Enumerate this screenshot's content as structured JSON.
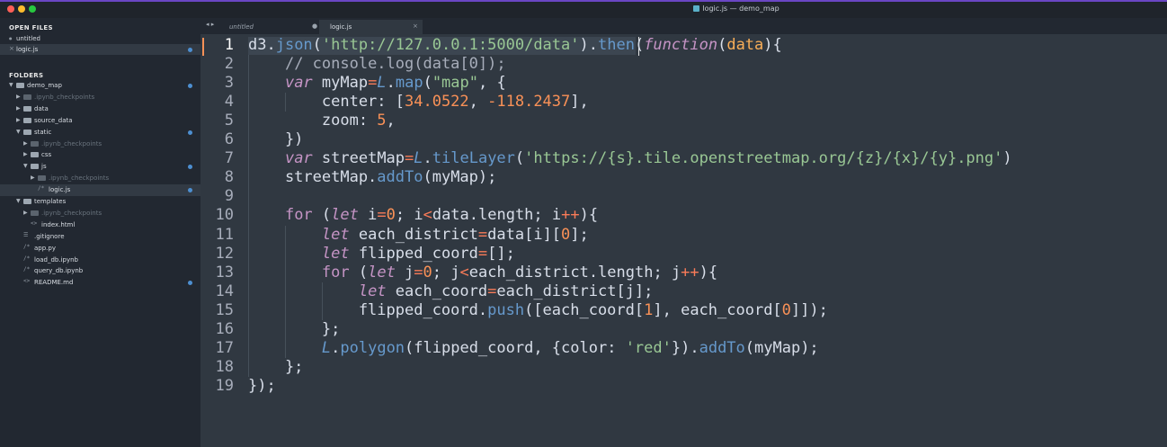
{
  "window": {
    "title": "logic.js — demo_map"
  },
  "sidebar": {
    "open_files_header": "OPEN FILES",
    "open_files": [
      {
        "label": "untitled",
        "marker": "●"
      },
      {
        "label": "logic.js",
        "marker": "×",
        "active": true
      }
    ],
    "folders_header": "FOLDERS",
    "tree": [
      {
        "label": "demo_map",
        "kind": "folder",
        "expanded": true,
        "depth": 0,
        "modified": true
      },
      {
        "label": ".ipynb_checkpoints",
        "kind": "folder",
        "depth": 1,
        "dim": true
      },
      {
        "label": "data",
        "kind": "folder",
        "depth": 1
      },
      {
        "label": "source_data",
        "kind": "folder",
        "depth": 1
      },
      {
        "label": "static",
        "kind": "folder",
        "expanded": true,
        "depth": 1,
        "modified": true
      },
      {
        "label": ".ipynb_checkpoints",
        "kind": "folder",
        "depth": 2,
        "dim": true
      },
      {
        "label": "css",
        "kind": "folder",
        "depth": 2
      },
      {
        "label": "js",
        "kind": "folder",
        "expanded": true,
        "depth": 2,
        "modified": true
      },
      {
        "label": ".ipynb_checkpoints",
        "kind": "folder",
        "depth": 3,
        "dim": true
      },
      {
        "label": "logic.js",
        "kind": "file",
        "icon": "/*",
        "depth": 3,
        "modified": true,
        "active": true
      },
      {
        "label": "templates",
        "kind": "folder",
        "expanded": true,
        "depth": 1
      },
      {
        "label": ".ipynb_checkpoints",
        "kind": "folder",
        "depth": 2,
        "dim": true
      },
      {
        "label": "index.html",
        "kind": "file",
        "icon": "<>",
        "depth": 2
      },
      {
        "label": ".gitignore",
        "kind": "file",
        "icon": "☰",
        "depth": 1
      },
      {
        "label": "app.py",
        "kind": "file",
        "icon": "/*",
        "depth": 1
      },
      {
        "label": "load_db.ipynb",
        "kind": "file",
        "icon": "/*",
        "depth": 1
      },
      {
        "label": "query_db.ipynb",
        "kind": "file",
        "icon": "/*",
        "depth": 1
      },
      {
        "label": "README.md",
        "kind": "file",
        "icon": "<>",
        "depth": 1,
        "modified": true
      }
    ]
  },
  "tabs": {
    "nav": "◂ ▸",
    "items": [
      {
        "label": "untitled",
        "control": "●"
      },
      {
        "label": "logic.js",
        "control": "×",
        "active": true
      }
    ]
  },
  "editor": {
    "current_line": 1,
    "lines": [
      [
        [
          "d3.",
          "p"
        ],
        [
          "json",
          "f"
        ],
        [
          "(",
          "p"
        ],
        [
          "'http://127.0.0.1:5000/data'",
          "s"
        ],
        [
          ").",
          "p"
        ],
        [
          "then",
          "f"
        ],
        [
          "(",
          "p"
        ],
        [
          "function",
          "ki"
        ],
        [
          "(",
          "p"
        ],
        [
          "data",
          "m"
        ],
        [
          "){",
          "p"
        ]
      ],
      [
        [
          "    ",
          " "
        ],
        [
          "// console.log(data[0]);",
          "c"
        ]
      ],
      [
        [
          "    ",
          " "
        ],
        [
          "var",
          "ki"
        ],
        [
          " myMap",
          "p"
        ],
        [
          "=",
          "o"
        ],
        [
          "L",
          "fi"
        ],
        [
          ".",
          "p"
        ],
        [
          "map",
          "f"
        ],
        [
          "(",
          "p"
        ],
        [
          "\"map\"",
          "s"
        ],
        [
          ", {",
          "p"
        ]
      ],
      [
        [
          "        center: [",
          "p"
        ],
        [
          "34.0522",
          "n"
        ],
        [
          ", ",
          "p"
        ],
        [
          "-118.2437",
          "n"
        ],
        [
          "],",
          "p"
        ]
      ],
      [
        [
          "        zoom: ",
          "p"
        ],
        [
          "5",
          "n"
        ],
        [
          ",",
          "p"
        ]
      ],
      [
        [
          "    })",
          "p"
        ]
      ],
      [
        [
          "    ",
          " "
        ],
        [
          "var",
          "ki"
        ],
        [
          " streetMap",
          "p"
        ],
        [
          "=",
          "o"
        ],
        [
          "L",
          "fi"
        ],
        [
          ".",
          "p"
        ],
        [
          "tileLayer",
          "f"
        ],
        [
          "(",
          "p"
        ],
        [
          "'https://{s}.tile.openstreetmap.org/{z}/{x}/{y}.png'",
          "s"
        ],
        [
          ")",
          "p"
        ]
      ],
      [
        [
          "    streetMap.",
          "p"
        ],
        [
          "addTo",
          "f"
        ],
        [
          "(myMap);",
          "p"
        ]
      ],
      [
        [
          "",
          "p"
        ]
      ],
      [
        [
          "    ",
          " "
        ],
        [
          "for",
          "k"
        ],
        [
          " (",
          "p"
        ],
        [
          "let",
          "ki"
        ],
        [
          " i",
          "p"
        ],
        [
          "=",
          "o"
        ],
        [
          "0",
          "n"
        ],
        [
          "; i",
          "p"
        ],
        [
          "<",
          "o"
        ],
        [
          "data.length; i",
          "p"
        ],
        [
          "++",
          "o"
        ],
        [
          "){",
          "p"
        ]
      ],
      [
        [
          "        ",
          " "
        ],
        [
          "let",
          "ki"
        ],
        [
          " each_district",
          "p"
        ],
        [
          "=",
          "o"
        ],
        [
          "data[i][",
          "p"
        ],
        [
          "0",
          "n"
        ],
        [
          "];",
          "p"
        ]
      ],
      [
        [
          "        ",
          " "
        ],
        [
          "let",
          "ki"
        ],
        [
          " flipped_coord",
          "p"
        ],
        [
          "=",
          "o"
        ],
        [
          "[];",
          "p"
        ]
      ],
      [
        [
          "        ",
          " "
        ],
        [
          "for",
          "k"
        ],
        [
          " (",
          "p"
        ],
        [
          "let",
          "ki"
        ],
        [
          " j",
          "p"
        ],
        [
          "=",
          "o"
        ],
        [
          "0",
          "n"
        ],
        [
          "; j",
          "p"
        ],
        [
          "<",
          "o"
        ],
        [
          "each_district.length; j",
          "p"
        ],
        [
          "++",
          "o"
        ],
        [
          "){",
          "p"
        ]
      ],
      [
        [
          "            ",
          " "
        ],
        [
          "let",
          "ki"
        ],
        [
          " each_coord",
          "p"
        ],
        [
          "=",
          "o"
        ],
        [
          "each_district[j];",
          "p"
        ]
      ],
      [
        [
          "            flipped_coord.",
          "p"
        ],
        [
          "push",
          "f"
        ],
        [
          "([each_coord[",
          "p"
        ],
        [
          "1",
          "n"
        ],
        [
          "], each_coord[",
          "p"
        ],
        [
          "0",
          "n"
        ],
        [
          "]]);",
          "p"
        ]
      ],
      [
        [
          "        };",
          "p"
        ]
      ],
      [
        [
          "        ",
          " "
        ],
        [
          "L",
          "fi"
        ],
        [
          ".",
          "p"
        ],
        [
          "polygon",
          "f"
        ],
        [
          "(flipped_coord, {color: ",
          "p"
        ],
        [
          "'red'",
          "s"
        ],
        [
          "}).",
          "p"
        ],
        [
          "addTo",
          "f"
        ],
        [
          "(myMap);",
          "p"
        ]
      ],
      [
        [
          "    };",
          "p"
        ]
      ],
      [
        [
          "});",
          "p"
        ]
      ]
    ]
  }
}
